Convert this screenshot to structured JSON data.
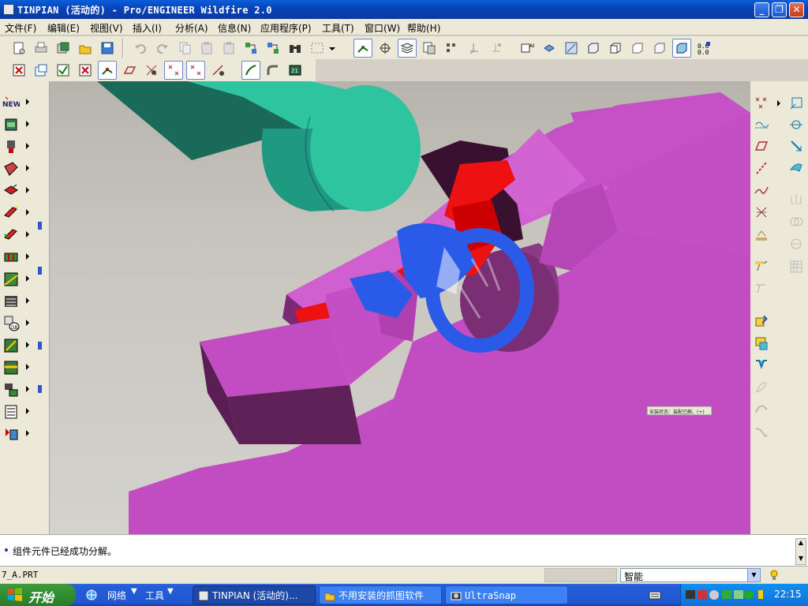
{
  "window": {
    "title": "TINPIAN (活动的) - Pro/ENGINEER Wildfire 2.0",
    "min_icon": "minimize-icon",
    "max_icon": "restore-icon",
    "close_icon": "close-icon"
  },
  "menu": [
    "文件(F)",
    "编辑(E)",
    "视图(V)",
    "插入(I)",
    "分析(A)",
    "信息(N)",
    "应用程序(P)",
    "工具(T)",
    "窗口(W)",
    "帮助(H)"
  ],
  "message_area": {
    "message": "组件元件已经成功分解。"
  },
  "status_bar": {
    "filename": "7_A.PRT",
    "filter_value": "智能"
  },
  "graphics": {
    "tooltip_text": "安装状态：装配已解。(+)"
  },
  "taskbar": {
    "start_label": "开始",
    "quicklaunch": [
      "网络",
      "工具"
    ],
    "tasks": [
      {
        "label": "TINPIAN (活动的)...",
        "active": true
      },
      {
        "label": "不用安装的抓图软件",
        "active": false
      },
      {
        "label": "UltraSnap",
        "active": false
      }
    ],
    "clock": "22:15"
  },
  "colors": {
    "title_blue": "#0a5fd8",
    "magenta_part": "#c44fc4",
    "teal_part": "#2ec4a0",
    "red_part": "#ee1111",
    "blue_part": "#2a5ae8"
  }
}
